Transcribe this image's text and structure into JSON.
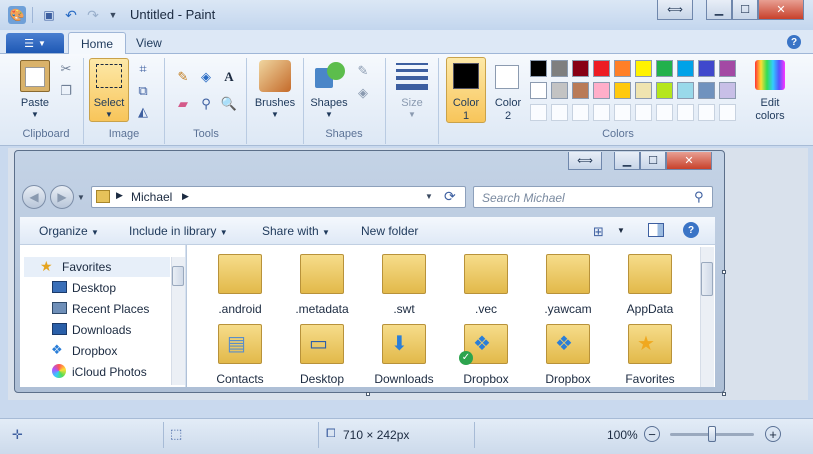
{
  "window": {
    "title": "Untitled - Paint"
  },
  "tabs": [
    {
      "label": "Home"
    },
    {
      "label": "View"
    }
  ],
  "clipboard": {
    "paste_label": "Paste",
    "group": "Clipboard"
  },
  "image": {
    "select_label": "Select",
    "group": "Image"
  },
  "tools": {
    "group": "Tools"
  },
  "brushes": {
    "label": "Brushes"
  },
  "shapes": {
    "label": "Shapes",
    "group": "Shapes"
  },
  "size": {
    "label": "Size"
  },
  "colors": {
    "color1_label": "Color",
    "color1_num": "1",
    "color2_label": "Color",
    "color2_num": "2",
    "group": "Colors",
    "edit_label_1": "Edit",
    "edit_label_2": "colors",
    "row1": [
      "#000000",
      "#7f7f7f",
      "#880015",
      "#ed1c24",
      "#ff7f27",
      "#fff200",
      "#22b14c",
      "#00a2e8",
      "#3f48cc",
      "#a349a4"
    ],
    "row2": [
      "#ffffff",
      "#c3c3c3",
      "#b97a57",
      "#ffaec9",
      "#ffc90e",
      "#efe4b0",
      "#b5e61d",
      "#99d9ea",
      "#7092be",
      "#c8bfe7"
    ],
    "color1": "#000000",
    "color2": "#ffffff"
  },
  "explorer": {
    "breadcrumb": "Michael",
    "search_placeholder": "Search Michael",
    "cmd": {
      "organize": "Organize",
      "include": "Include in library",
      "share": "Share with",
      "new_folder": "New folder"
    },
    "nav": [
      {
        "label": "Favorites"
      },
      {
        "label": "Desktop"
      },
      {
        "label": "Recent Places"
      },
      {
        "label": "Downloads"
      },
      {
        "label": "Dropbox"
      },
      {
        "label": "iCloud Photos"
      }
    ],
    "files_row1": [
      {
        "name": ".android"
      },
      {
        "name": ".metadata"
      },
      {
        "name": ".swt"
      },
      {
        "name": ".vec"
      },
      {
        "name": ".yawcam"
      },
      {
        "name": "AppData"
      }
    ],
    "files_row2": [
      {
        "name": "Contacts"
      },
      {
        "name": "Desktop"
      },
      {
        "name": "Downloads"
      },
      {
        "name": "Dropbox"
      },
      {
        "name": "Dropbox"
      },
      {
        "name": "Favorites"
      }
    ]
  },
  "status": {
    "size": "710 × 242px",
    "zoom": "100%",
    "zoom_level": 0.5
  }
}
